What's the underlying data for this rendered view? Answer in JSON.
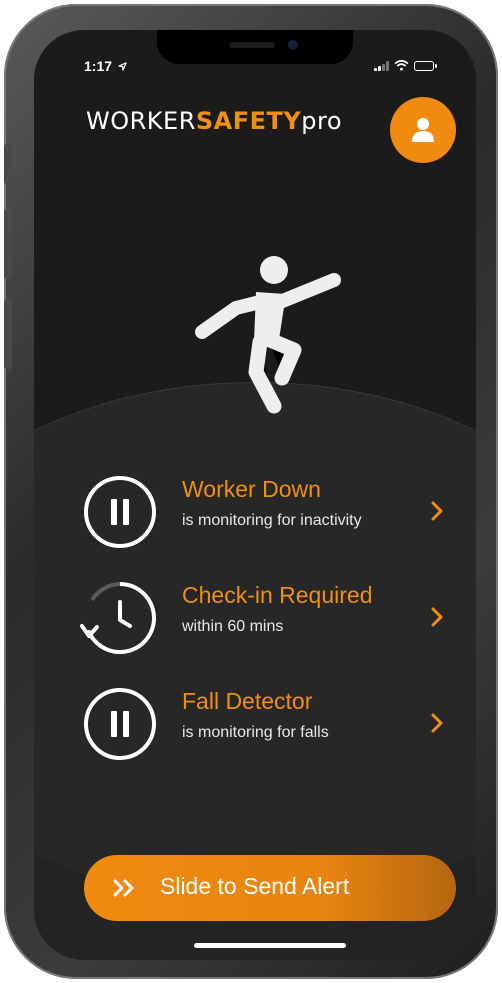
{
  "status_bar": {
    "time": "1:17"
  },
  "header": {
    "logo_part1": "WORKER",
    "logo_part2": "SAFETY",
    "logo_part3": "pro",
    "profile_icon": "user-icon"
  },
  "hero": {
    "icon": "person-falling-icon"
  },
  "monitors": [
    {
      "title": "Worker Down",
      "subtitle": "is monitoring for inactivity",
      "icon": "pause-icon"
    },
    {
      "title": "Check-in Required",
      "subtitle": "within 60 mins",
      "icon": "timer-icon"
    },
    {
      "title": "Fall Detector",
      "subtitle": "is monitoring for falls",
      "icon": "pause-icon"
    }
  ],
  "slider": {
    "label": "Slide to Send Alert",
    "icon": "double-chevron-right-icon"
  },
  "colors": {
    "accent": "#f0900e",
    "background": "#232323",
    "text": "#ffffff"
  }
}
